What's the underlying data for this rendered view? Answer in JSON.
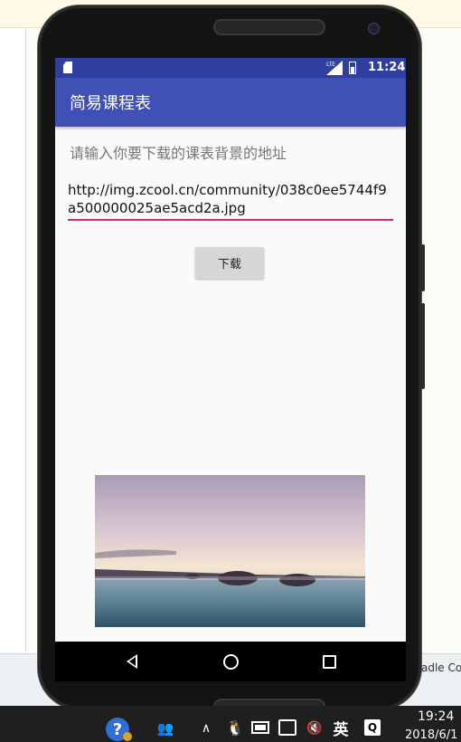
{
  "app": {
    "title": "简易课程表"
  },
  "status_bar": {
    "network_label": "LTE",
    "time": "11:24"
  },
  "main": {
    "prompt": "请输入你要下载的课表背景的地址",
    "url_value": "http://img.zcool.cn/community/038c0ee5744f9a500000025ae5acd2a.jpg",
    "download_label": "下载"
  },
  "navigation": {
    "back_icon": "back-triangle-icon",
    "home_icon": "home-circle-icon",
    "recent_icon": "recent-apps-square-icon"
  },
  "desktop": {
    "ide_snippet": "adle Co",
    "taskbar": {
      "time": "19:24",
      "date": "2018/6/1",
      "ime_label": "英",
      "search_label": "Q",
      "help_label": "?"
    }
  },
  "colors": {
    "primary": "#3f51b5",
    "primary_dark": "#303f9f",
    "accent": "#e91e63"
  }
}
